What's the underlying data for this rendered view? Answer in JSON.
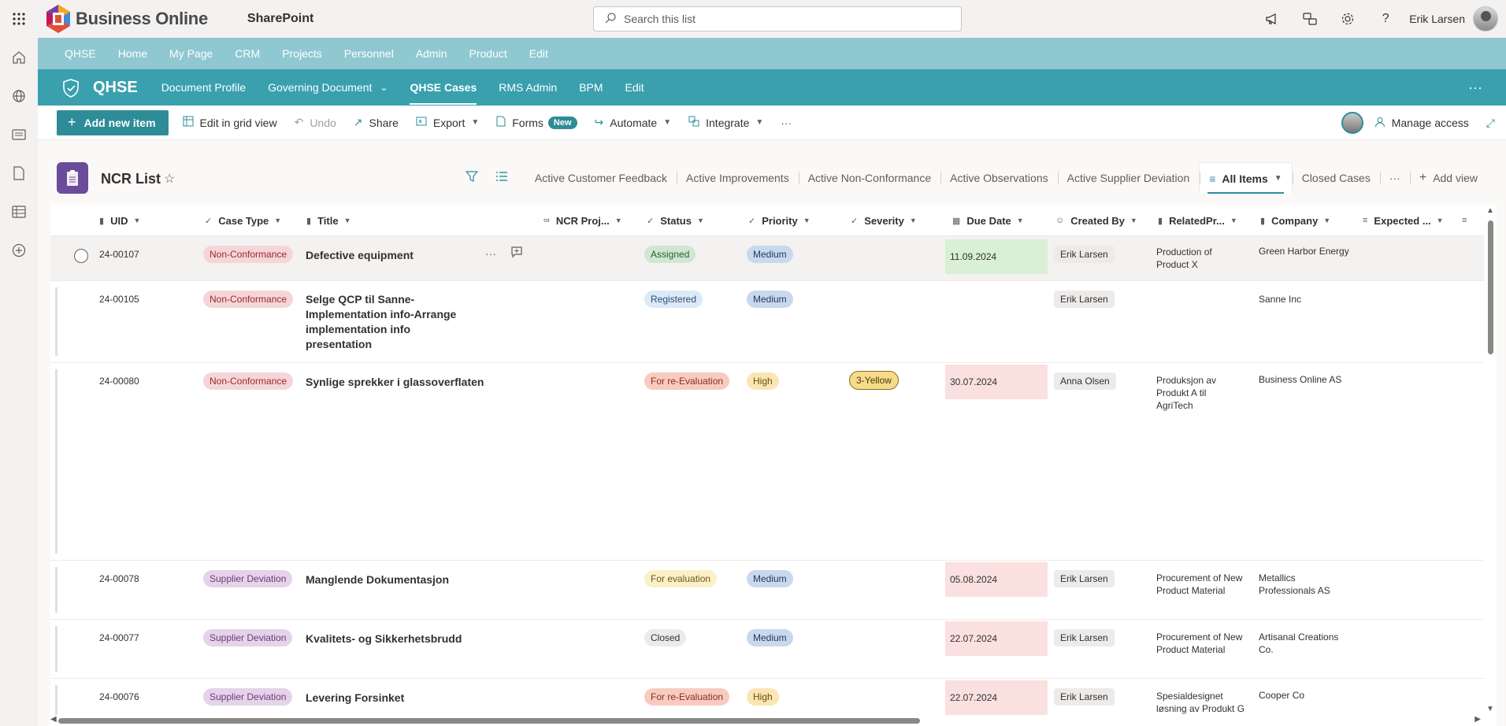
{
  "app": {
    "brand": "Business Online",
    "suite": "SharePoint",
    "search_placeholder": "Search this list",
    "user_name": "Erik Larsen"
  },
  "hubnav": [
    "QHSE",
    "Home",
    "My Page",
    "CRM",
    "Projects",
    "Personnel",
    "Admin",
    "Product",
    "Edit"
  ],
  "sitenav": {
    "title": "QHSE",
    "items": [
      {
        "label": "Document Profile"
      },
      {
        "label": "Governing Document",
        "dropdown": true
      },
      {
        "label": "QHSE Cases",
        "active": true
      },
      {
        "label": "RMS Admin"
      },
      {
        "label": "BPM"
      },
      {
        "label": "Edit"
      }
    ]
  },
  "commands": {
    "add_new": "Add new item",
    "edit_grid": "Edit in grid view",
    "undo": "Undo",
    "share": "Share",
    "export": "Export",
    "forms": "Forms",
    "forms_badge": "New",
    "automate": "Automate",
    "integrate": "Integrate",
    "manage_access": "Manage access"
  },
  "list": {
    "title": "NCR List",
    "views": [
      "Active Customer Feedback",
      "Active Improvements",
      "Active Non-Conformance",
      "Active Observations",
      "Active Supplier Deviation",
      "All Items",
      "Closed Cases"
    ],
    "active_view": "All Items",
    "add_view": "Add view"
  },
  "columns": [
    "UID",
    "Case Type",
    "Title",
    "NCR Proj...",
    "Status",
    "Priority",
    "Severity",
    "Due Date",
    "Created By",
    "RelatedPr...",
    "Company",
    "Expected ..."
  ],
  "rows": [
    {
      "uid": "24-00107",
      "case_type": "Non-Conformance",
      "title": "Defective equipment",
      "status": "Assigned",
      "priority": "Medium",
      "severity": "",
      "due": "11.09.2024",
      "created_by": "Erik Larsen",
      "related": "Production of Product X",
      "company": "Green Harbor Energy"
    },
    {
      "uid": "24-00105",
      "case_type": "Non-Conformance",
      "title": "Selge QCP til Sanne-Implementation info-Arrange implementation info presentation",
      "status": "Registered",
      "priority": "Medium",
      "severity": "",
      "due": "",
      "created_by": "Erik Larsen",
      "related": "",
      "company": "Sanne Inc"
    },
    {
      "uid": "24-00080",
      "case_type": "Non-Conformance",
      "title": "Synlige sprekker i glassoverflaten",
      "status": "For re-Evaluation",
      "priority": "High",
      "severity": "3-Yellow",
      "due": "30.07.2024",
      "created_by": "Anna Olsen",
      "related": "Produksjon av Produkt A til AgriTech",
      "company": "Business Online AS"
    },
    {
      "uid": "24-00078",
      "case_type": "Supplier Deviation",
      "title": "Manglende Dokumentasjon",
      "status": "For evaluation",
      "priority": "Medium",
      "severity": "",
      "due": "05.08.2024",
      "created_by": "Erik Larsen",
      "related": "Procurement of New Product Material",
      "company": "Metallics Professionals AS"
    },
    {
      "uid": "24-00077",
      "case_type": "Supplier Deviation",
      "title": "Kvalitets- og Sikkerhetsbrudd",
      "status": "Closed",
      "priority": "Medium",
      "severity": "",
      "due": "22.07.2024",
      "created_by": "Erik Larsen",
      "related": "Procurement of New Product Material",
      "company": "Artisanal Creations Co."
    },
    {
      "uid": "24-00076",
      "case_type": "Supplier Deviation",
      "title": "Levering Forsinket",
      "status": "For re-Evaluation",
      "priority": "High",
      "severity": "",
      "due": "22.07.2024",
      "created_by": "Erik Larsen",
      "related": "Spesialdesignet løsning av Produkt G",
      "company": "Cooper Co"
    }
  ]
}
